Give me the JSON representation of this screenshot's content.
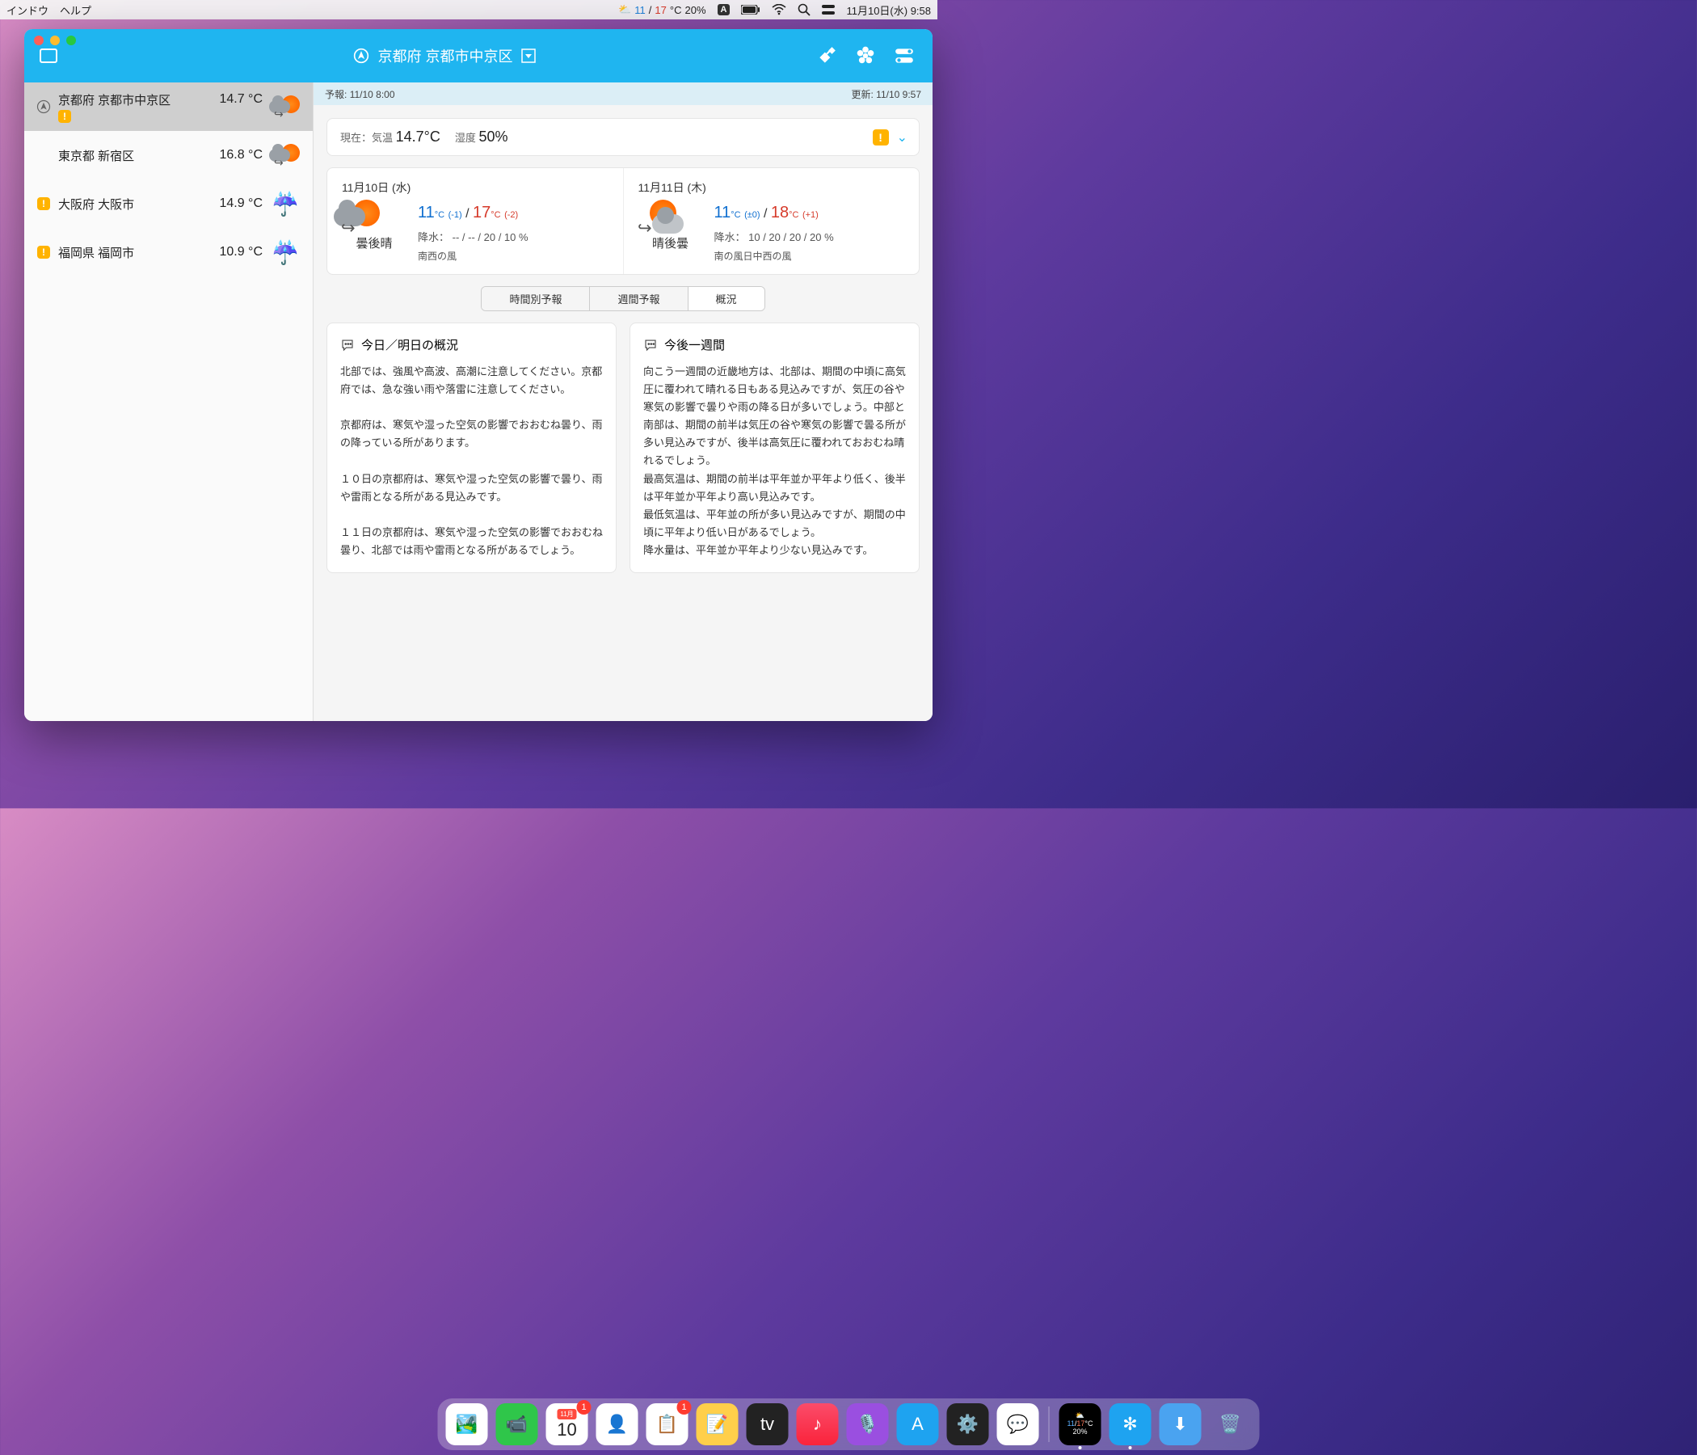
{
  "menubar": {
    "left": [
      "インドウ",
      "ヘルプ"
    ],
    "weather": {
      "lo": "11",
      "hi": "17",
      "unit": "°C",
      "pct": "20%"
    },
    "indicator_a": "A",
    "datetime": "11月10日(水) 9:58"
  },
  "window": {
    "title_location": "京都府 京都市中京区"
  },
  "sidebar": {
    "items": [
      {
        "name": "京都府 京都市中京区",
        "temp": "14.7 °C",
        "alert": true,
        "locate": true,
        "icon": "suncloud"
      },
      {
        "name": "東京都 新宿区",
        "temp": "16.8 °C",
        "alert": false,
        "locate": false,
        "icon": "suncloud"
      },
      {
        "name": "大阪府 大阪市",
        "temp": "14.9 °C",
        "alert": true,
        "locate": false,
        "icon": "rain"
      },
      {
        "name": "福岡県 福岡市",
        "temp": "10.9 °C",
        "alert": true,
        "locate": false,
        "icon": "rain"
      }
    ]
  },
  "meta": {
    "forecast_label": "予報:",
    "forecast_time": "11/10 8:00",
    "update_label": "更新:",
    "update_time": "11/10 9:57"
  },
  "current": {
    "label_now": "現在：気温",
    "temp": "14.7°C",
    "label_hum": "湿度",
    "hum": "50%"
  },
  "days": [
    {
      "date": "11月10日 (水)",
      "condition": "曇後晴",
      "lo": "11",
      "lo_unit": "°C",
      "lo_diff": "(-1)",
      "hi": "17",
      "hi_unit": "°C",
      "hi_diff": "(-2)",
      "precip_label": "降水：",
      "precip": "-- / -- / 20 / 10 %",
      "wind": "南西の風"
    },
    {
      "date": "11月11日 (木)",
      "condition": "晴後曇",
      "lo": "11",
      "lo_unit": "°C",
      "lo_diff": "(±0)",
      "hi": "18",
      "hi_unit": "°C",
      "hi_diff": "(+1)",
      "precip_label": "降水：",
      "precip": "10 / 20 / 20 / 20 %",
      "wind": "南の風日中西の風"
    }
  ],
  "segments": {
    "hourly": "時間別予報",
    "weekly": "週間予報",
    "overview": "概況"
  },
  "overview": {
    "today_title": "今日／明日の概況",
    "today_text": "北部では、強風や高波、高潮に注意してください。京都府では、急な強い雨や落雷に注意してください。\n\n京都府は、寒気や湿った空気の影響でおおむね曇り、雨の降っている所があります。\n\n１０日の京都府は、寒気や湿った空気の影響で曇り、雨や雷雨となる所がある見込みです。\n\n１１日の京都府は、寒気や湿った空気の影響でおおむね曇り、北部では雨や雷雨となる所があるでしょう。",
    "week_title": "今後一週間",
    "week_text": "向こう一週間の近畿地方は、北部は、期間の中頃に高気圧に覆われて晴れる日もある見込みですが、気圧の谷や寒気の影響で曇りや雨の降る日が多いでしょう。中部と南部は、期間の前半は気圧の谷や寒気の影響で曇る所が多い見込みですが、後半は高気圧に覆われておおむね晴れるでしょう。\n最高気温は、期間の前半は平年並か平年より低く、後半は平年並か平年より高い見込みです。\n最低気温は、平年並の所が多い見込みですが、期間の中頃に平年より低い日があるでしょう。\n降水量は、平年並か平年より少ない見込みです。"
  },
  "dock": {
    "calendar_month": "11月",
    "calendar_day": "10",
    "calendar_badge": "1",
    "reminders_badge": "1",
    "widget_lo": "11",
    "widget_hi": "17",
    "widget_unit": "°C",
    "widget_pct": "20%"
  }
}
